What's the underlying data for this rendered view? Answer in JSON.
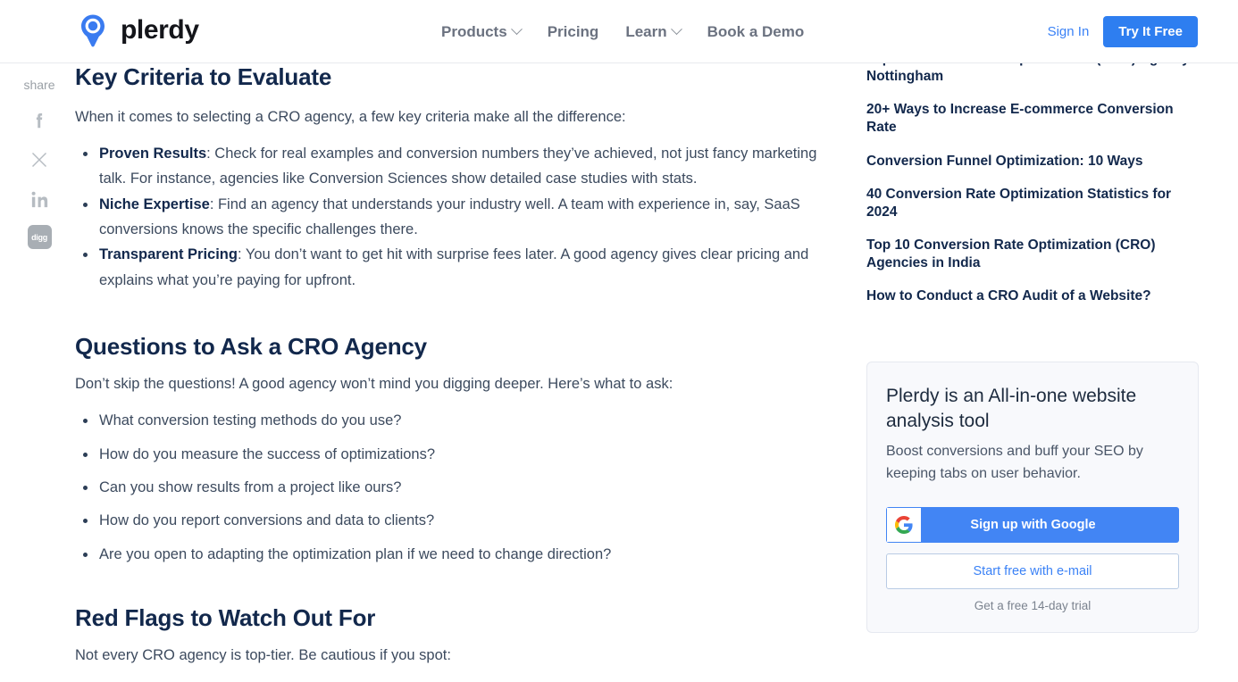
{
  "header": {
    "brand": "plerdy",
    "logo_icon": "plerdy-pin-logo-icon",
    "nav": [
      {
        "label": "Products",
        "has_dropdown": true
      },
      {
        "label": "Pricing",
        "has_dropdown": false
      },
      {
        "label": "Learn",
        "has_dropdown": true
      },
      {
        "label": "Book a Demo",
        "has_dropdown": false
      }
    ],
    "sign_in": "Sign In",
    "try_free": "Try It Free",
    "accent_color": "#2e7ef0",
    "link_color": "#3b82f6"
  },
  "share_rail": {
    "label": "share",
    "items": [
      {
        "name": "facebook-icon",
        "label": "f"
      },
      {
        "name": "x-twitter-icon",
        "label": "X"
      },
      {
        "name": "linkedin-icon",
        "label": "in"
      },
      {
        "name": "digg-icon",
        "label": "digg"
      }
    ]
  },
  "article": {
    "heading_color": "#12284c",
    "sections": [
      {
        "title": "Key Criteria to Evaluate",
        "lede": "When it comes to selecting a CRO agency, a few key criteria make all the difference:",
        "bullets": [
          {
            "lead": "Proven Results",
            "text": ": Check for real examples and conversion numbers they’ve achieved, not just fancy marketing talk. For instance, agencies like Conversion Sciences show detailed case studies with stats."
          },
          {
            "lead": "Niche Expertise",
            "text": ": Find an agency that understands your industry well. A team with experience in, say, SaaS conversions knows the specific challenges there."
          },
          {
            "lead": "Transparent Pricing",
            "text": ": You don’t want to get hit with surprise fees later. A good agency gives clear pricing and explains what you’re paying for upfront."
          }
        ]
      },
      {
        "title": "Questions to Ask a CRO Agency",
        "lede": "Don’t skip the questions! A good agency won’t mind you digging deeper. Here’s what to ask:",
        "bullets": [
          {
            "lead": "",
            "text": "What conversion testing methods do you use?"
          },
          {
            "lead": "",
            "text": "How do you measure the success of optimizations?"
          },
          {
            "lead": "",
            "text": "Can you show results from a project like ours?"
          },
          {
            "lead": "",
            "text": "How do you report conversions and data to clients?"
          },
          {
            "lead": "",
            "text": "Are you open to adapting the optimization plan if we need to change direction?"
          }
        ]
      },
      {
        "title": "Red Flags to Watch Out For",
        "lede": "Not every CRO agency is top-tier. Be cautious if you spot:",
        "bullets": []
      }
    ]
  },
  "sidebar": {
    "related_links": [
      "Top Conversion Rate Optimization (CRO) Agency Nottingham",
      "20+ Ways to Increase E-commerce Conversion Rate",
      "Conversion Funnel Optimization: 10 Ways",
      "40 Conversion Rate Optimization Statistics for 2024",
      "Top 10 Conversion Rate Optimization (CRO) Agencies in India",
      "How to Conduct a CRO Audit of a Website?"
    ]
  },
  "promo": {
    "title": "Plerdy is an All-in-one website analysis tool",
    "subtitle": "Boost conversions and buff your SEO by keeping tabs on user behavior.",
    "google_button": "Sign up with Google",
    "google_icon": "google-g-icon",
    "email_button": "Start free with e-mail",
    "trial_note": "Get a free 14-day trial",
    "google_blue": "#4285f4",
    "card_bg": "#f8f9fc"
  }
}
